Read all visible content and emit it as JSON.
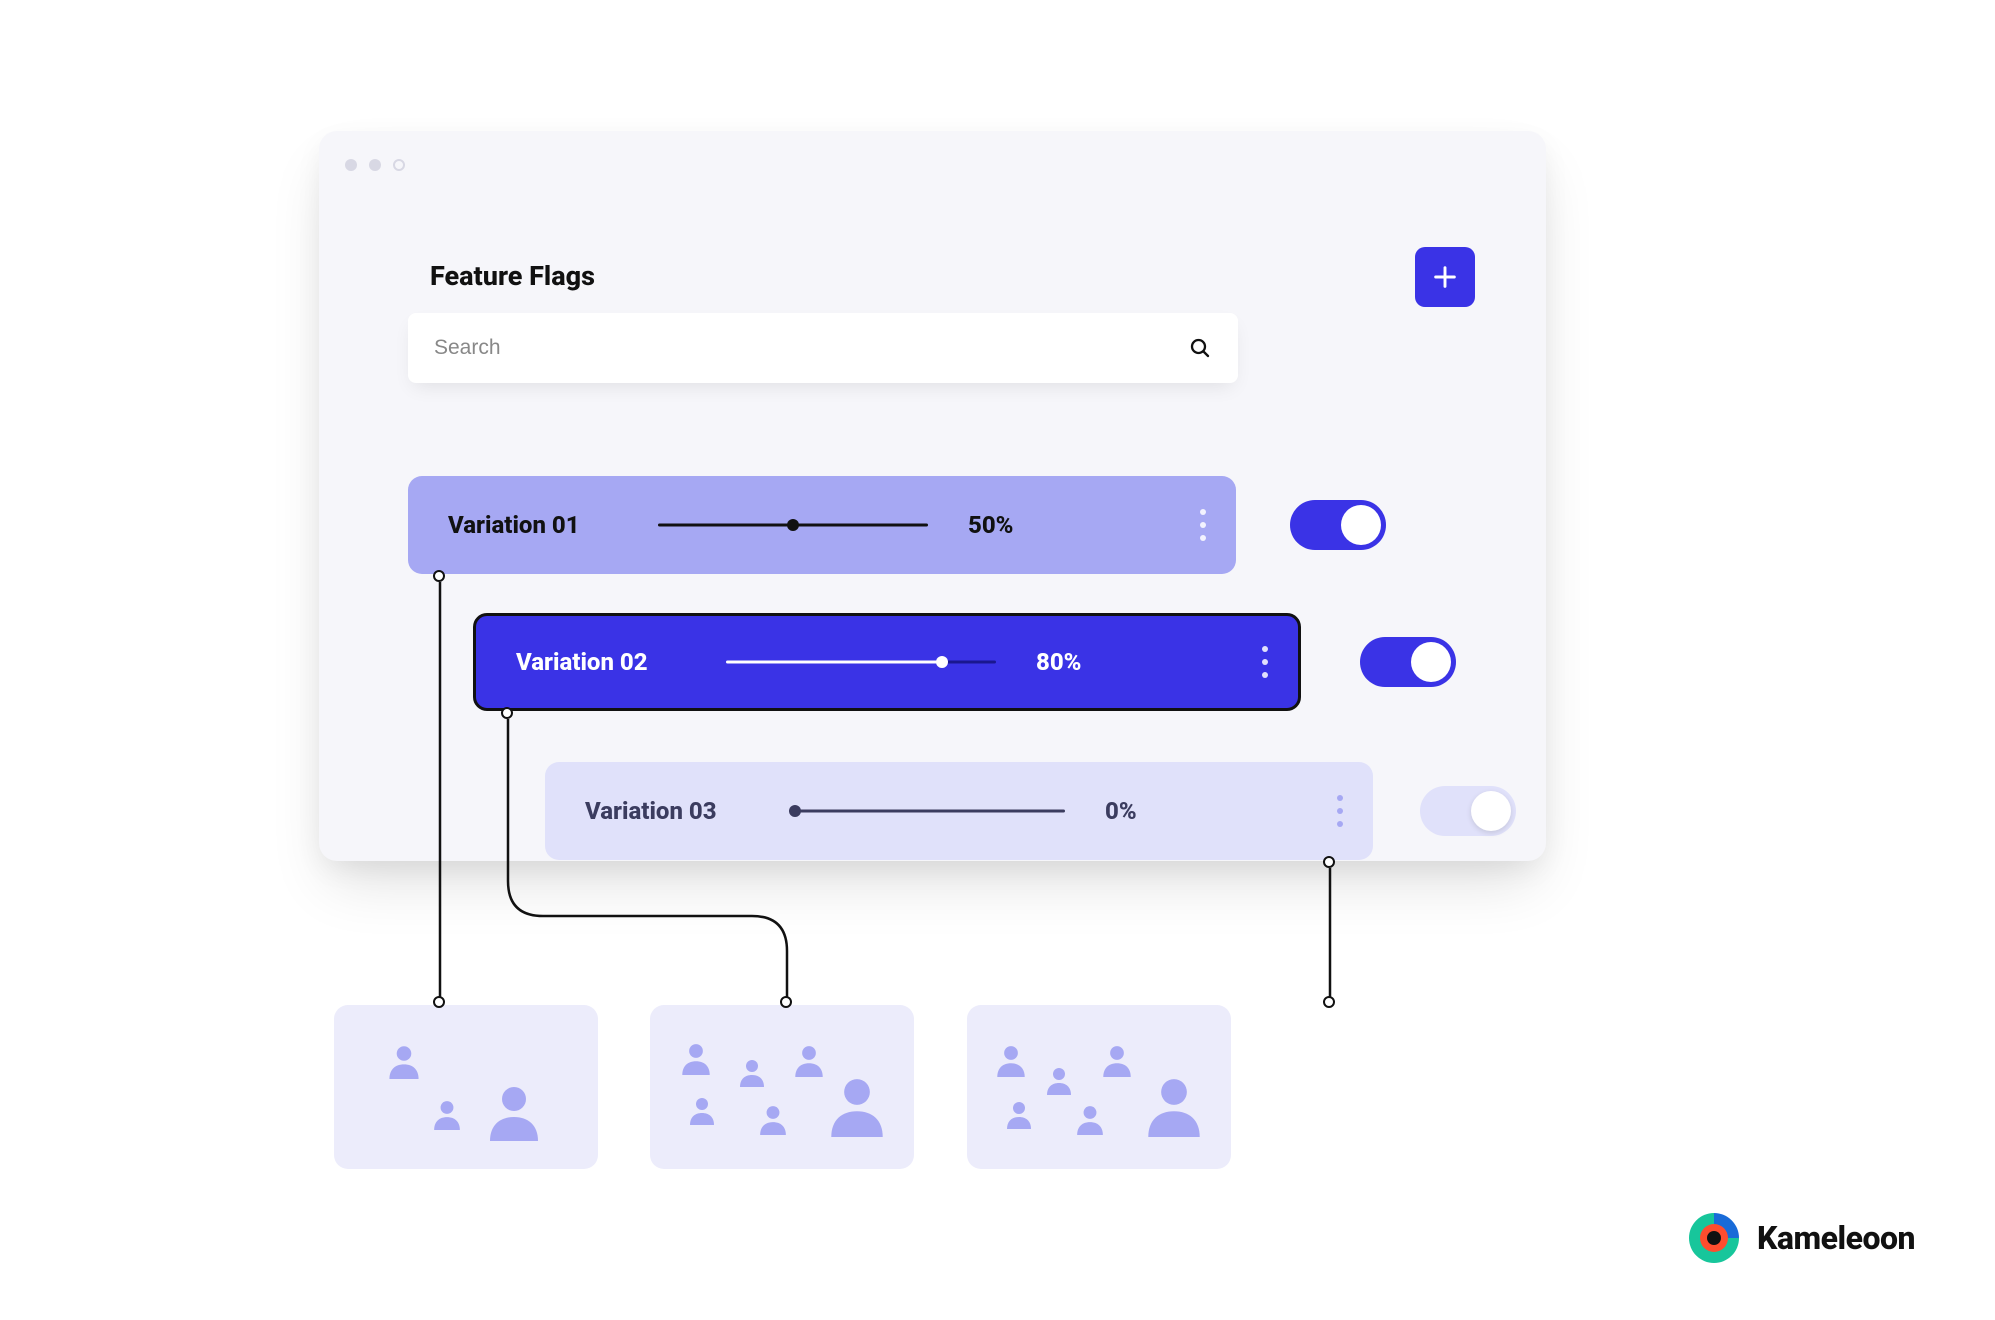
{
  "title": "Feature Flags",
  "search": {
    "placeholder": "Search"
  },
  "add_button": {
    "label": "+"
  },
  "variations": [
    {
      "label": "Variation 01",
      "percent_label": "50%",
      "percent": 50,
      "toggle_on": true,
      "style": "light"
    },
    {
      "label": "Variation 02",
      "percent_label": "80%",
      "percent": 80,
      "toggle_on": true,
      "style": "primary"
    },
    {
      "label": "Variation 03",
      "percent_label": "0%",
      "percent": 0,
      "toggle_on": false,
      "style": "pale"
    }
  ],
  "brand": {
    "name": "Kameleoon"
  }
}
